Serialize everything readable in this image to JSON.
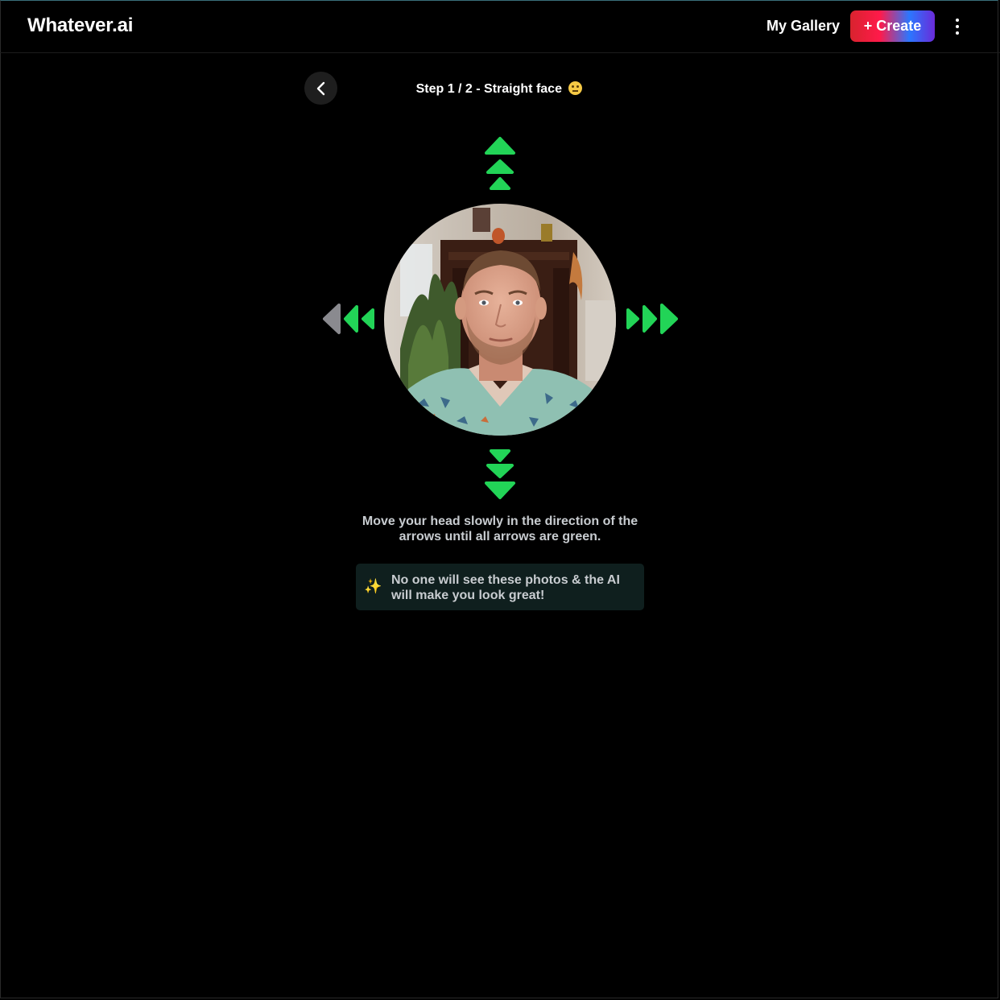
{
  "header": {
    "logo": "Whatever.ai",
    "gallery_label": "My Gallery",
    "create_label": "+ Create"
  },
  "step": {
    "title": "Step 1 / 2 - Straight face",
    "emoji": "neutral-face"
  },
  "arrows": {
    "up": [
      "green",
      "green",
      "green"
    ],
    "right": [
      "green",
      "green",
      "green"
    ],
    "down": [
      "green",
      "green",
      "green"
    ],
    "left": [
      "green",
      "green",
      "gray"
    ],
    "colors": {
      "green": "#22d457",
      "gray": "#8a8a8f"
    }
  },
  "instructions": "Move your head slowly in the direction of the arrows until all arrows are green.",
  "note": {
    "icon": "sparkles-icon",
    "text": "No one will see these photos & the AI will make you look great!"
  },
  "colors": {
    "background": "#000000",
    "note_bg": "#0f1f1e",
    "text_muted": "#c8ccd0"
  }
}
